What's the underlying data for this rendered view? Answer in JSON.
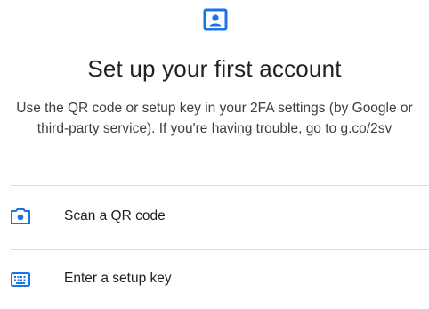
{
  "header": {
    "icon": "account-box-icon",
    "title": "Set up your first account",
    "description": "Use the QR code or setup key in your 2FA settings (by Google or third-party service). If you're having trouble, go to g.co/2sv"
  },
  "options": [
    {
      "icon": "camera-icon",
      "label": "Scan a QR code"
    },
    {
      "icon": "keyboard-icon",
      "label": "Enter a setup key"
    }
  ],
  "colors": {
    "accent": "#1a73e8",
    "text": "#202124",
    "secondary_text": "#3c4043",
    "divider": "#dadce0"
  }
}
